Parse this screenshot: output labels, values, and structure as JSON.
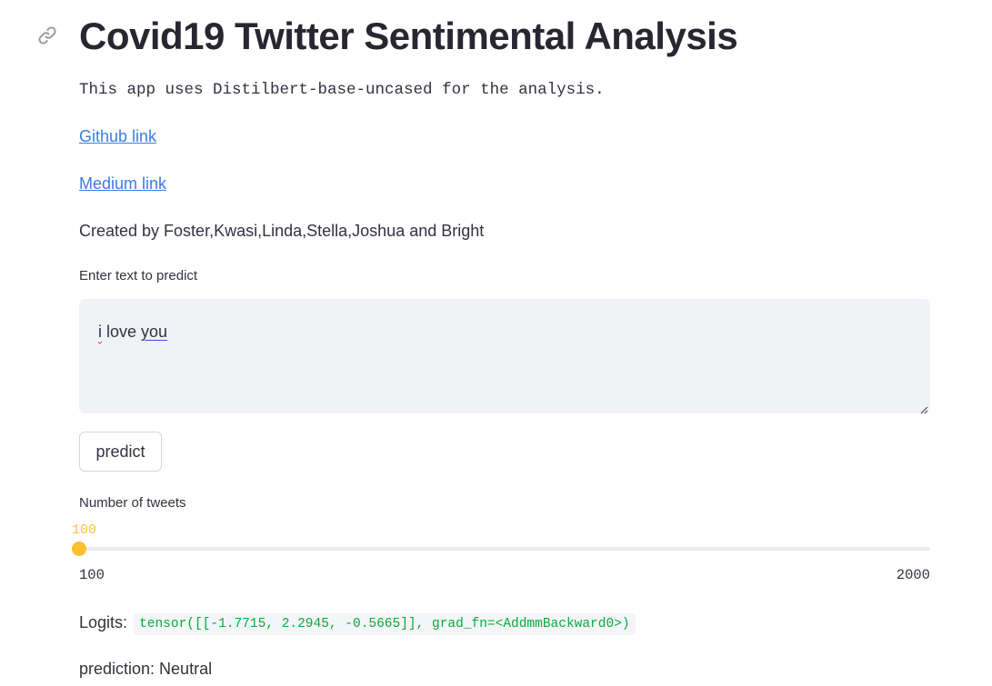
{
  "header": {
    "title": "Covid19 Twitter Sentimental Analysis",
    "anchor_icon": "link-icon"
  },
  "intro": {
    "code_text": "This app uses Distilbert-base-uncased for the analysis.",
    "github_link": "Github link",
    "medium_link": "Medium link",
    "created_by": "Created by Foster,Kwasi,Linda,Stella,Joshua and Bright"
  },
  "text_input": {
    "label": "Enter text to predict",
    "value_part1": "i",
    "value_part2": " love ",
    "value_part3": "you"
  },
  "predict_button": {
    "label": "predict"
  },
  "tweets_slider": {
    "label": "Number of tweets",
    "value": "100",
    "min": "100",
    "max": "2000",
    "fraction": 0.0,
    "accent_color": "#f6c344"
  },
  "results": {
    "logits_label": "Logits:",
    "logits_value": "tensor([[-1.7715, 2.2945, -0.5665]], grad_fn=<AddmmBackward0>)",
    "prediction": "prediction: Neutral"
  }
}
